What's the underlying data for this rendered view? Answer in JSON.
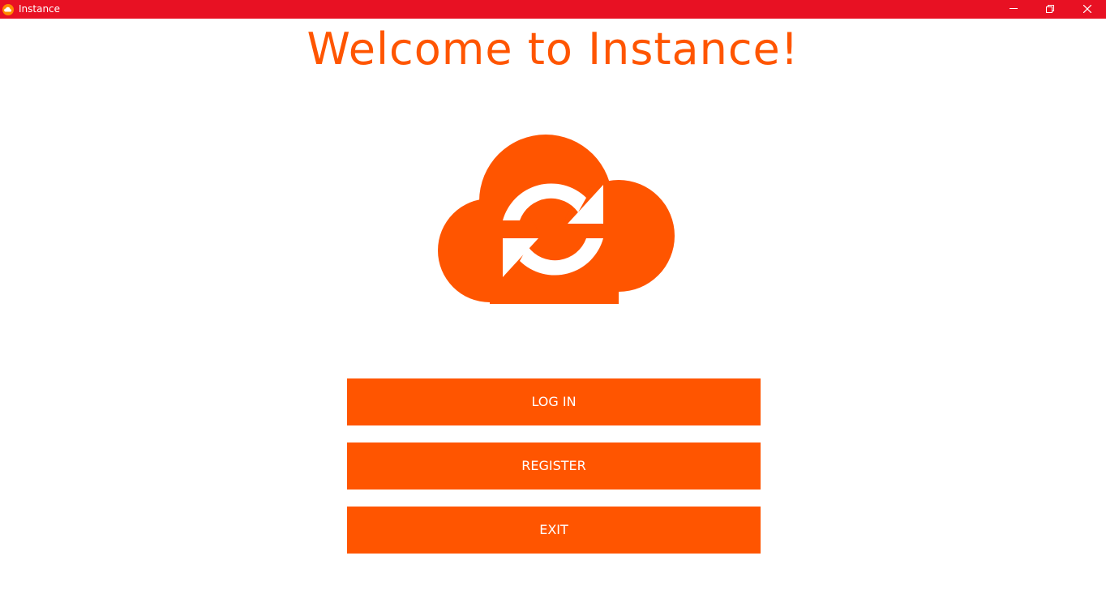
{
  "window": {
    "title": "Instance",
    "icon": "cloud-sync-icon",
    "titlebar_color": "#e81123",
    "controls": [
      "minimize-icon",
      "restore-icon",
      "close-icon"
    ]
  },
  "main": {
    "heading": "Welcome to Instance!",
    "logo": "cloud-sync-icon",
    "accent_color": "#ff5500"
  },
  "buttons": {
    "login_label": "LOG IN",
    "register_label": "REGISTER",
    "exit_label": "EXIT"
  }
}
